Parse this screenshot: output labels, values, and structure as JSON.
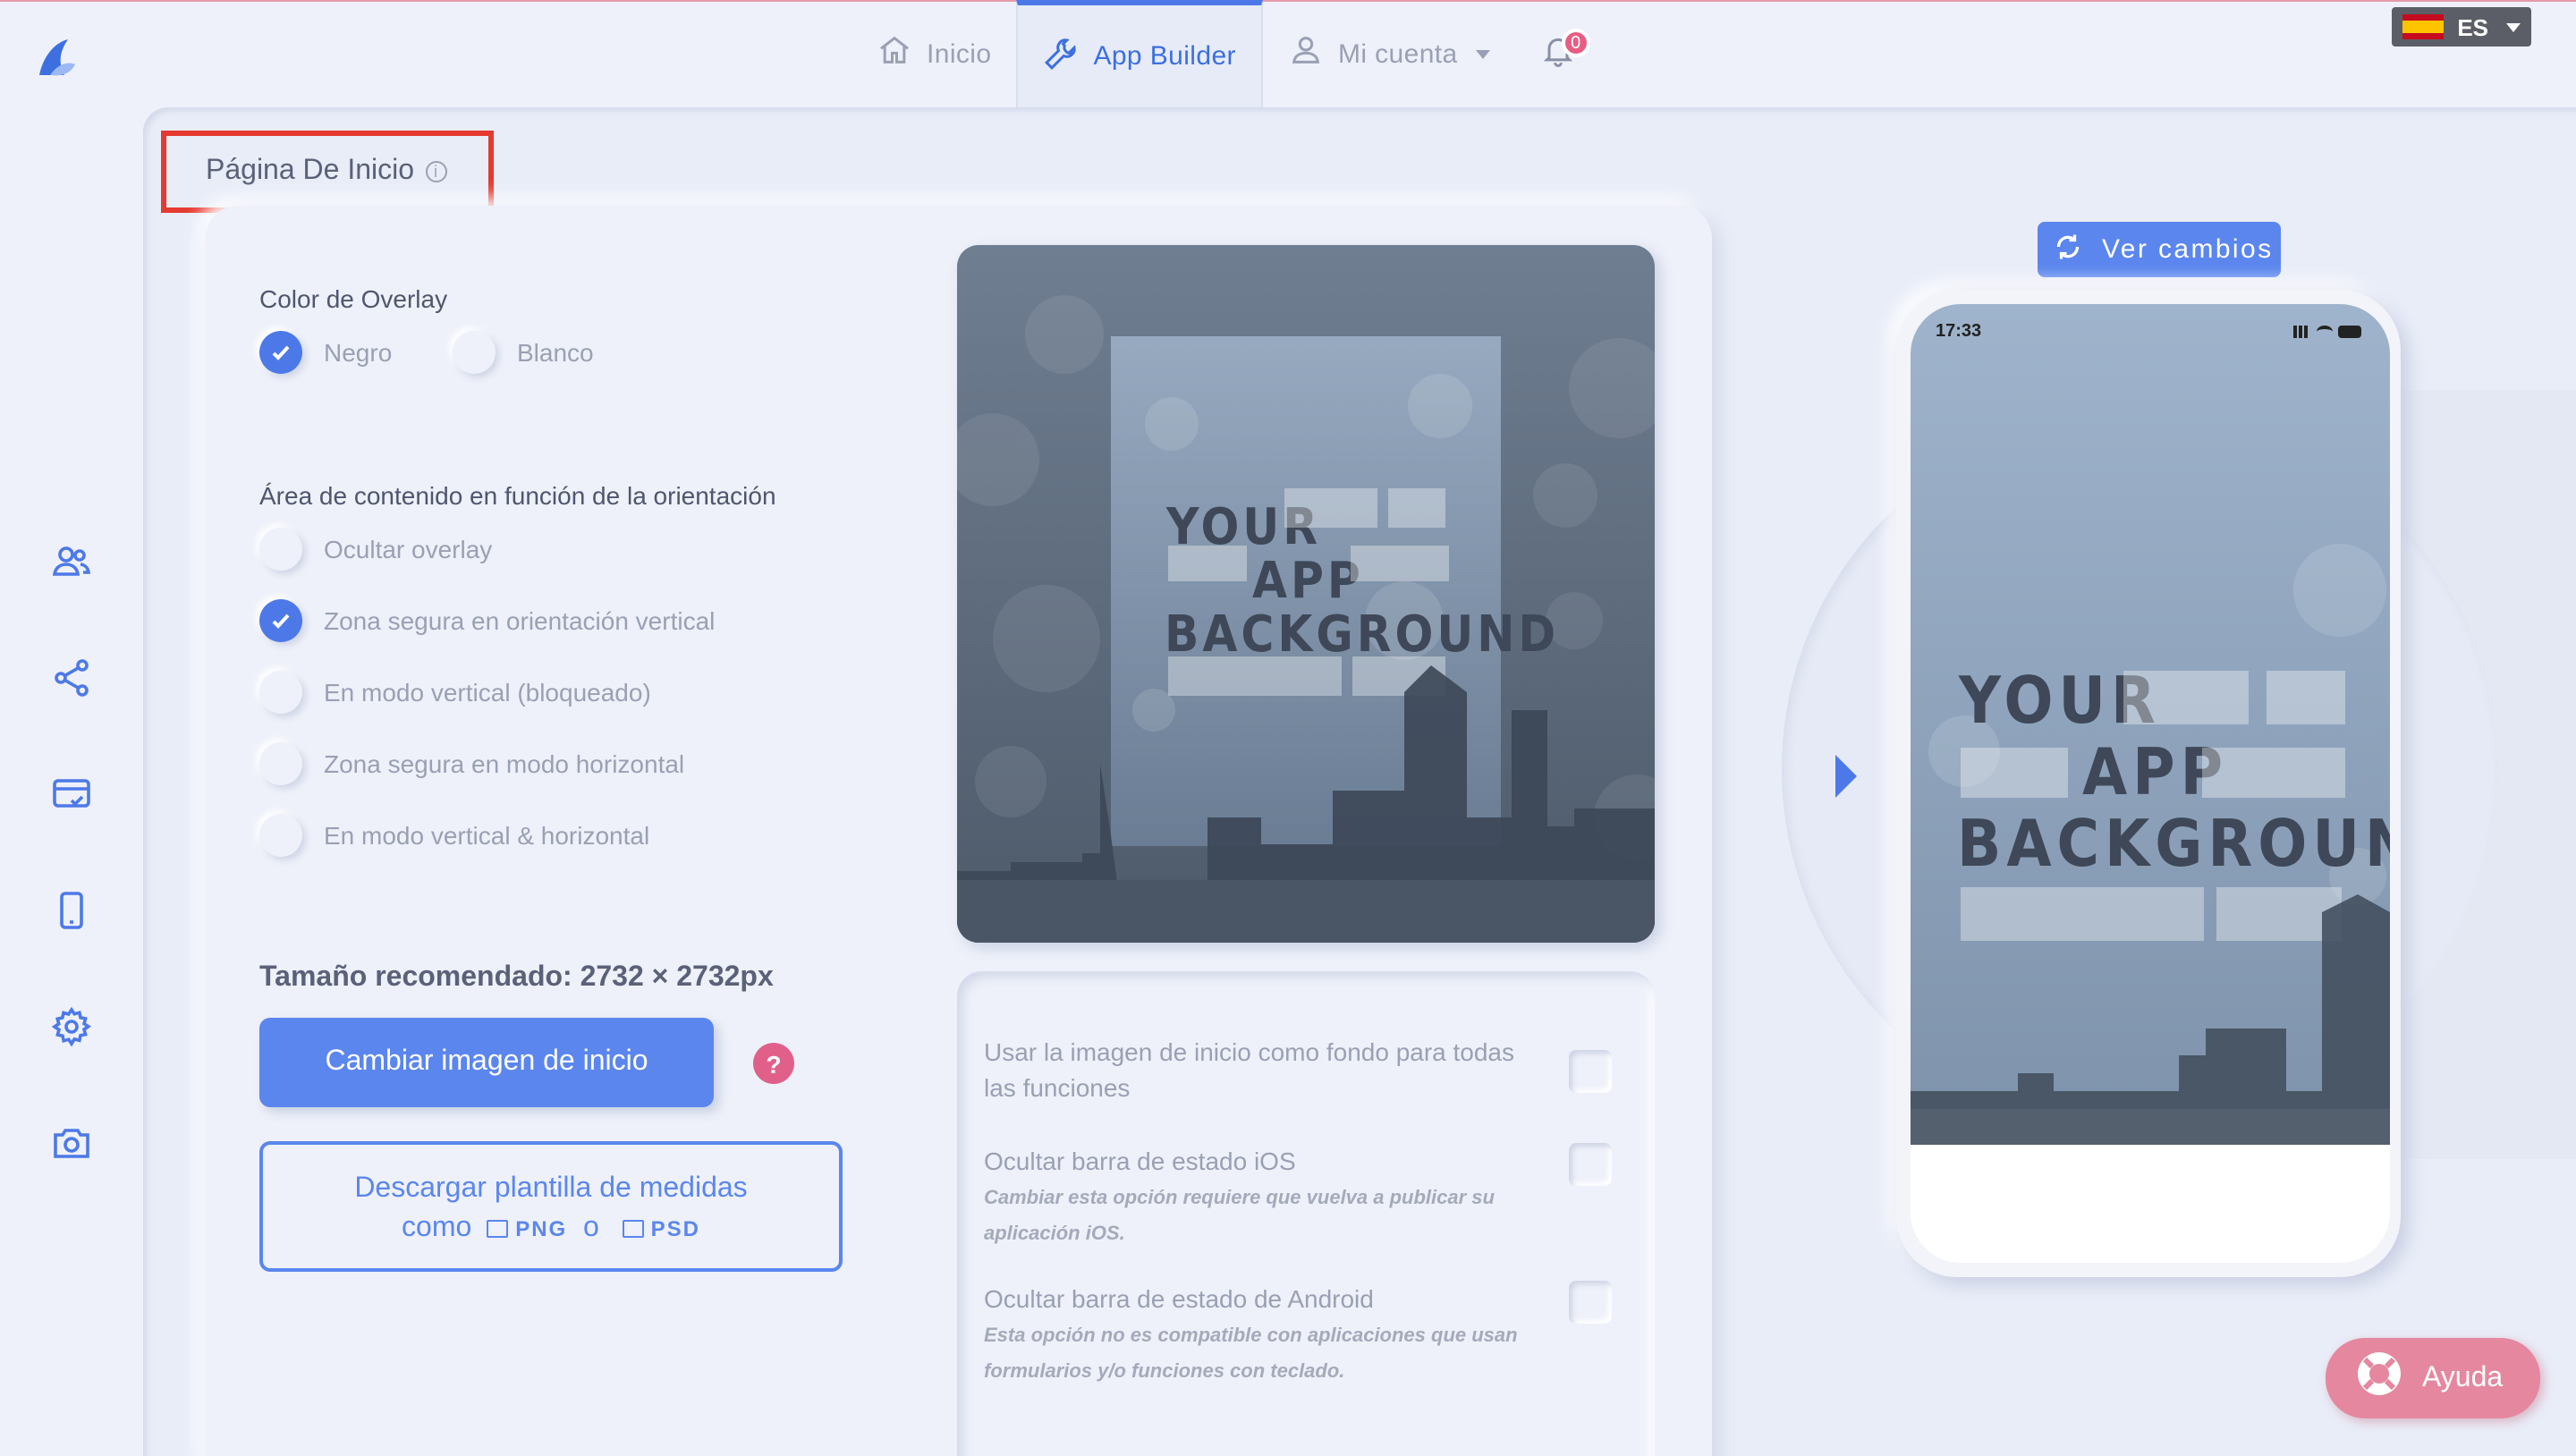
{
  "nav": {
    "home_label": "Inicio",
    "builder_label": "App Builder",
    "account_label": "Mi cuenta",
    "notifications_count": "0"
  },
  "language": {
    "code": "ES"
  },
  "page": {
    "title": "Página De Inicio"
  },
  "overlay": {
    "label": "Color de Overlay",
    "options": [
      {
        "label": "Negro",
        "selected": true
      },
      {
        "label": "Blanco",
        "selected": false
      }
    ]
  },
  "orientation": {
    "label": "Área de contenido en función de la orientación",
    "options": [
      {
        "label": "Ocultar overlay",
        "selected": false
      },
      {
        "label": "Zona segura en orientación vertical",
        "selected": true
      },
      {
        "label": "En modo vertical (bloqueado)",
        "selected": false
      },
      {
        "label": "Zona segura en modo horizontal",
        "selected": false
      },
      {
        "label": "En modo vertical & horizontal",
        "selected": false
      }
    ]
  },
  "image": {
    "recommended_size": "Tamaño recomendado: 2732 × 2732px",
    "change_button": "Cambiar imagen de inicio",
    "help_mark": "?",
    "download_line1": "Descargar plantilla de medidas",
    "download_como": "como",
    "download_png": "PNG",
    "download_o": "o",
    "download_psd": "PSD"
  },
  "preview_text": {
    "line1": "YOUR",
    "line2": "APP",
    "line3": "BACKGROUND"
  },
  "settings": [
    {
      "title": "Usar la imagen de inicio como fondo para todas las funciones",
      "note": "",
      "checked": false
    },
    {
      "title": "Ocultar barra de estado iOS",
      "note": "Cambiar esta opción requiere que vuelva a publicar su aplicación iOS.",
      "checked": false
    },
    {
      "title": "Ocultar barra de estado de Android",
      "note": "Esta opción no es compatible con aplicaciones que usan formularios y/o funciones con teclado.",
      "checked": false
    }
  ],
  "phone": {
    "ver_cambios": "Ver cambios",
    "time": "17:33"
  },
  "help": {
    "label": "Ayuda"
  },
  "colors": {
    "accent": "#4d79e8",
    "highlight": "#e53a2f",
    "help": "#e5879f"
  }
}
